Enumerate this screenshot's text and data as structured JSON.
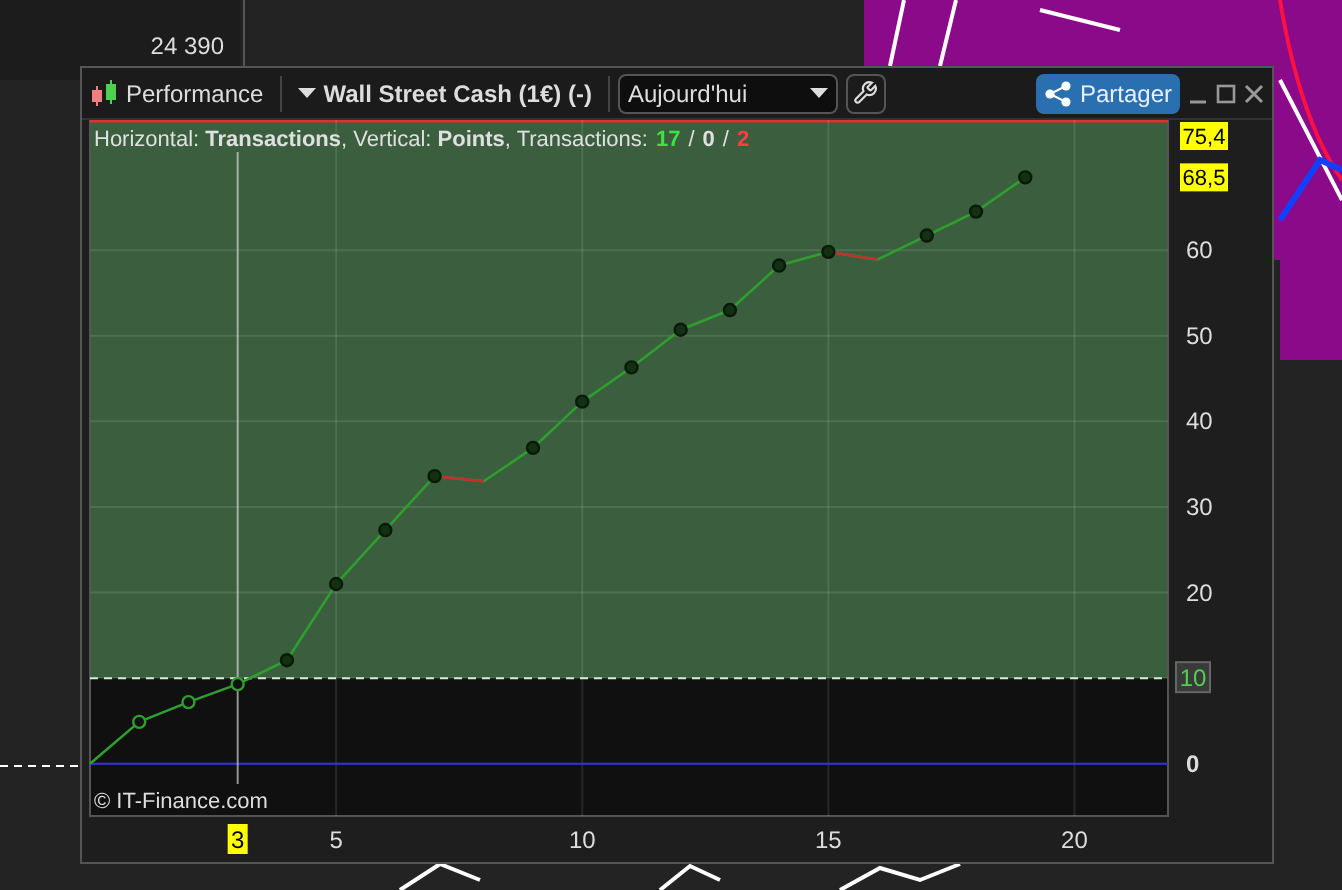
{
  "background": {
    "price_label": "24 390"
  },
  "window": {
    "title": "Performance",
    "instrument": "Wall Street Cash (1€) (-)",
    "period": "Aujourd'hui",
    "share_button": "Partager"
  },
  "legend": {
    "prefix": "Horizontal: **Transactions**, Vertical: **Points**, Transactions:",
    "wins": "17",
    "separators": [
      "/",
      "/"
    ],
    "neutral": "0",
    "losses": "2"
  },
  "chart": {
    "value_markers": [
      "75,4",
      "68,5"
    ],
    "cursor_label": "3",
    "copyright": "© IT-Finance.com",
    "chart_data": {
      "type": "line",
      "x": [
        0,
        1,
        2,
        3,
        4,
        5,
        6,
        7,
        8,
        9,
        10,
        11,
        12,
        13,
        14,
        15,
        16,
        17,
        18,
        19
      ],
      "series": [
        {
          "color": "#2e9e2e",
          "marker": "o",
          "values": [
            0,
            4.9,
            7.2,
            9.3,
            12.1,
            21,
            27.3,
            33.6,
            33,
            36.9,
            42.3,
            46.3,
            50.7,
            53,
            58.2,
            59.8,
            58.9,
            61.7,
            64.5,
            68.5
          ]
        }
      ],
      "xlim": [
        0,
        21.9
      ],
      "ylim": [
        -6.1,
        75.2
      ],
      "xticks": [
        5,
        10,
        15,
        20
      ],
      "yticks": [
        0,
        10,
        20,
        30,
        40,
        50,
        60
      ],
      "grid": true,
      "ref_lines": [
        {
          "axis": "y",
          "value": 0,
          "color": "#3030e0"
        },
        {
          "axis": "y",
          "value": 10,
          "color": "#d0f0d0"
        },
        {
          "axis": "x",
          "value": 3,
          "color": "#e8e8e8"
        }
      ],
      "bands": [
        {
          "axis": "y",
          "from": 10,
          "to": 75.2,
          "color": "#3b5e3f"
        },
        {
          "axis": "y",
          "from": -6.1,
          "to": 10,
          "color": "#101010"
        }
      ]
    }
  }
}
